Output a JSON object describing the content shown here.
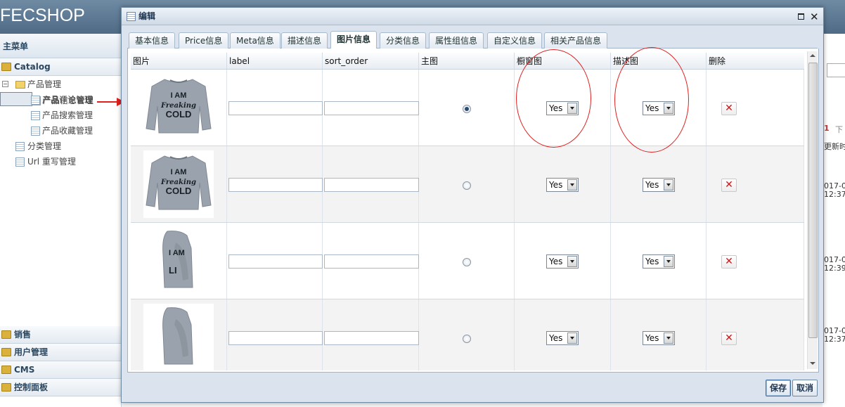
{
  "app": {
    "logo": "FECSHOP"
  },
  "sidebar": {
    "header": "主菜单",
    "catalog_label": "Catalog",
    "tree": {
      "group_label": "产品管理",
      "items": [
        "产品信息管理",
        "产品评论管理",
        "产品搜索管理",
        "产品收藏管理"
      ],
      "category": "分类管理",
      "url_rewrite": "Url 重写管理"
    },
    "bottom_sections": [
      "销售",
      "用户管理",
      "CMS",
      "控制面板"
    ]
  },
  "background_right": {
    "page_num": "1",
    "next": "下",
    "col_header": "更新时",
    "dates": [
      {
        "d": "017-0",
        "t": "12:37"
      },
      {
        "d": "017-0",
        "t": "12:39"
      },
      {
        "d": "017-0",
        "t": "12:37"
      }
    ]
  },
  "dialog": {
    "title": "编辑",
    "tabs": [
      "基本信息",
      "Price信息",
      "Meta信息",
      "描述信息",
      "图片信息",
      "分类信息",
      "属性组信息",
      "自定义信息",
      "相关产品信息"
    ],
    "active_tab": "图片信息",
    "columns": [
      "图片",
      "label",
      "sort_order",
      "主图",
      "橱窗图",
      "描述图",
      "删除"
    ],
    "rows": [
      {
        "image_text": [
          "I AM",
          "Freaking",
          "COLD"
        ],
        "label": "",
        "sort_order": "",
        "main": true,
        "showcase": "Yes",
        "desc_img": "Yes"
      },
      {
        "image_text": [
          "I AM",
          "Freaking",
          "COLD"
        ],
        "label": "",
        "sort_order": "",
        "main": false,
        "showcase": "Yes",
        "desc_img": "Yes"
      },
      {
        "image_text": [
          "I AM",
          "",
          "LI"
        ],
        "label": "",
        "sort_order": "",
        "main": false,
        "showcase": "Yes",
        "desc_img": "Yes"
      },
      {
        "image_text": [
          "",
          "",
          ""
        ],
        "label": "",
        "sort_order": "",
        "main": false,
        "showcase": "Yes",
        "desc_img": "Yes"
      }
    ],
    "delete_glyph": "✕",
    "buttons": {
      "save": "保存",
      "cancel": "取消"
    }
  },
  "colors": {
    "annotation_red": "#e0201f",
    "header_blue": "#4e6a85",
    "delete_red": "#d01414"
  }
}
